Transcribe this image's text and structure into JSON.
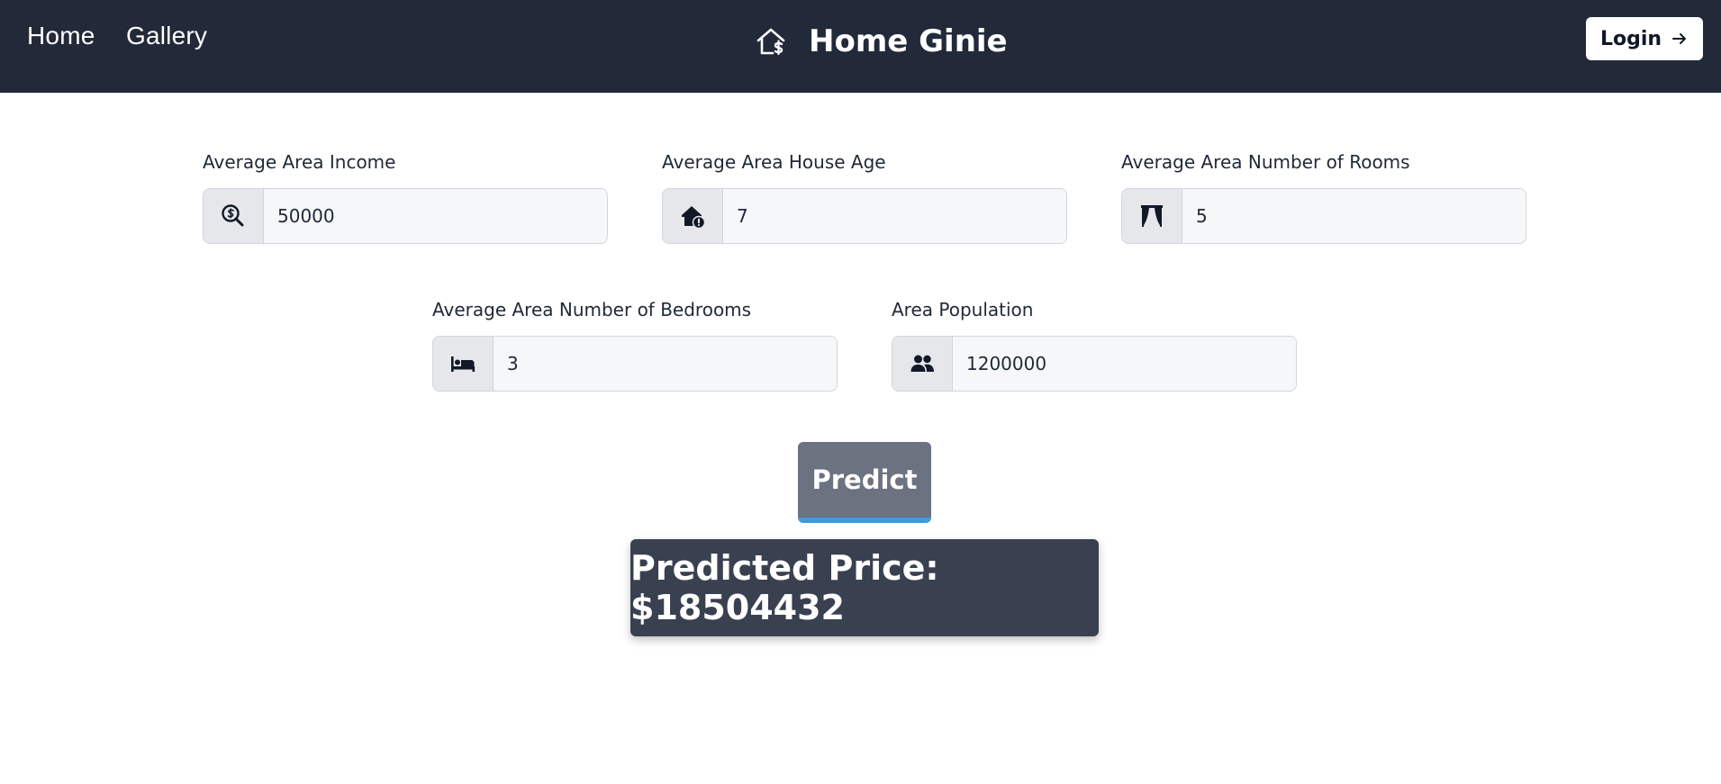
{
  "nav": {
    "links": [
      "Home",
      "Gallery"
    ],
    "brand": "Home Ginie",
    "brand_icon": "house-dollar-icon",
    "login_label": "Login",
    "login_icon": "arrow-right-icon",
    "background": "#222a39"
  },
  "form": {
    "fields": [
      {
        "label": "Average Area Income",
        "value": "50000",
        "icon": "search-dollar-icon"
      },
      {
        "label": "Average Area House Age",
        "value": "7",
        "icon": "house-clock-icon"
      },
      {
        "label": "Average Area Number of Rooms",
        "value": "5",
        "icon": "curtains-icon"
      },
      {
        "label": "Average Area Number of Bedrooms",
        "value": "3",
        "icon": "bed-icon"
      },
      {
        "label": "Area Population",
        "value": "1200000",
        "icon": "users-icon"
      }
    ]
  },
  "predict": {
    "label": "Predict",
    "accent": "#3b9be0"
  },
  "result": {
    "text": "Predicted Price: $18504432"
  }
}
